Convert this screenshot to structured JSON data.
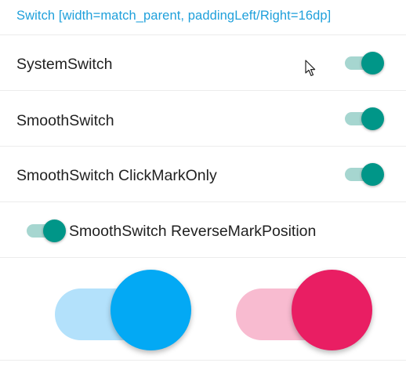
{
  "header": {
    "title": "Switch [width=match_parent, paddingLeft/Right=16dp]"
  },
  "rows": [
    {
      "label": "SystemSwitch",
      "checked": true
    },
    {
      "label": "SmoothSwitch",
      "checked": true
    },
    {
      "label": "SmoothSwitch ClickMarkOnly",
      "checked": true
    },
    {
      "label": "SmoothSwitch ReverseMarkPosition",
      "checked": true
    }
  ],
  "big_switches": [
    {
      "name": "blue",
      "checked": true
    },
    {
      "name": "pink",
      "checked": true
    }
  ],
  "colors": {
    "accent": "#1fa0db",
    "teal_thumb": "#009688",
    "teal_track": "#a6d6d0",
    "blue_thumb": "#03a9f4",
    "blue_track": "#b3e1fb",
    "pink_thumb": "#e91e63",
    "pink_track": "#f8bbd0",
    "text": "#212121",
    "divider": "#ececec"
  },
  "icons": {
    "cursor": "mouse-pointer-icon"
  }
}
